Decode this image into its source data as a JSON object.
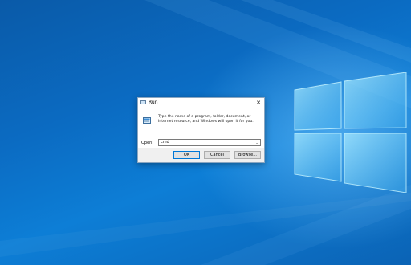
{
  "dialog": {
    "title": "Run",
    "close_glyph": "✕",
    "description": "Type the name of a program, folder, document, or Internet resource, and Windows will open it for you.",
    "open_label": "Open:",
    "open_value": "cmd",
    "dropdown_glyph": "⌄",
    "buttons": {
      "ok": "OK",
      "cancel": "Cancel",
      "browse": "Browse..."
    }
  },
  "colors": {
    "desktop_primary": "#0b6bc2",
    "accent": "#0078d7"
  },
  "icons": [
    "run-app-icon",
    "close-icon",
    "run-program-icon",
    "chevron-down-icon",
    "windows-logo"
  ]
}
